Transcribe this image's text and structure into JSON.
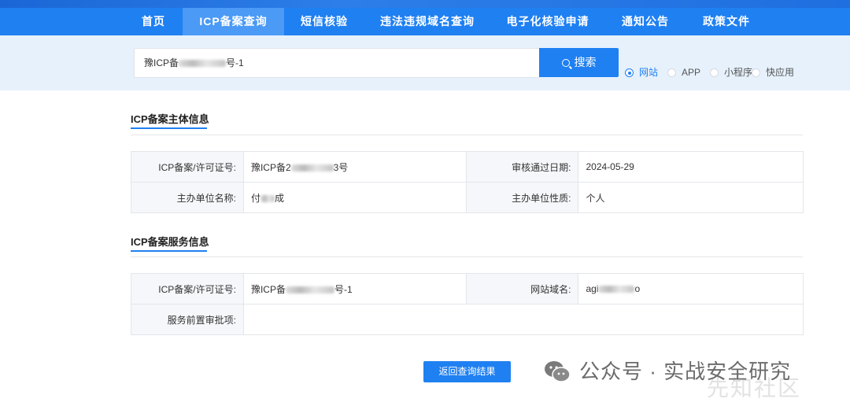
{
  "nav": {
    "items": [
      {
        "label": "首页",
        "active": false
      },
      {
        "label": "ICP备案查询",
        "active": true
      },
      {
        "label": "短信核验",
        "active": false
      },
      {
        "label": "违法违规域名查询",
        "active": false
      },
      {
        "label": "电子化核验申请",
        "active": false
      },
      {
        "label": "通知公告",
        "active": false
      },
      {
        "label": "政策文件",
        "active": false
      }
    ]
  },
  "search": {
    "value_prefix": "豫ICP备",
    "value_suffix": "号-1",
    "button_label": "搜索",
    "button_icon": "search-icon",
    "types": [
      {
        "label": "网站",
        "checked": true
      },
      {
        "label": "APP",
        "checked": false
      },
      {
        "label": "小程序",
        "checked": false
      },
      {
        "label": "快应用",
        "checked": false
      }
    ]
  },
  "subject": {
    "title": "ICP备案主体信息",
    "rows": [
      {
        "l1": "ICP备案/许可证号:",
        "v1_prefix": "豫ICP备2",
        "v1_suffix": "3号",
        "l2": "审核通过日期:",
        "v2": "2024-05-29"
      },
      {
        "l1": "主办单位名称:",
        "v1_prefix": "付",
        "v1_suffix": "成",
        "l2": "主办单位性质:",
        "v2": "个人"
      }
    ]
  },
  "service": {
    "title": "ICP备案服务信息",
    "rows": [
      {
        "l1": "ICP备案/许可证号:",
        "v1_prefix": "豫ICP备",
        "v1_suffix": "号-1",
        "l2": "网站域名:",
        "v2_prefix": "agi",
        "v2_suffix": "o"
      },
      {
        "l1": "服务前置审批项:",
        "v1": ""
      }
    ]
  },
  "back_button": "返回查询结果",
  "watermark": {
    "text": "公众号 · 实战安全研究",
    "secondary": "先知社区",
    "icon": "wechat-icon"
  },
  "colors": {
    "accent": "#1f80f2",
    "nav_active": "#4a9af6",
    "search_band": "#e6f1fc",
    "label_bg": "#f5f7fa"
  }
}
